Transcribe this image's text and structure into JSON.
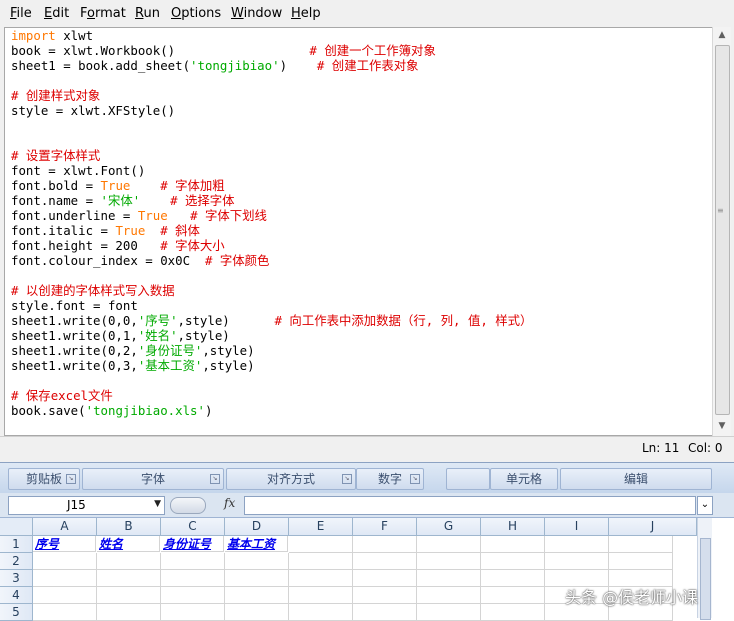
{
  "menu": [
    {
      "label": "File",
      "mnemonic": "F",
      "rest": "ile"
    },
    {
      "label": "Edit",
      "mnemonic": "E",
      "rest": "dit"
    },
    {
      "label": "Format",
      "mnemonic": "o",
      "pre": "F",
      "rest": "rmat"
    },
    {
      "label": "Run",
      "mnemonic": "R",
      "rest": "un"
    },
    {
      "label": "Options",
      "mnemonic": "O",
      "rest": "ptions"
    },
    {
      "label": "Window",
      "mnemonic": "W",
      "rest": "indow"
    },
    {
      "label": "Help",
      "mnemonic": "H",
      "rest": "elp"
    }
  ],
  "code_lines": [
    [
      {
        "t": "import",
        "c": "kw"
      },
      {
        "t": " xlwt"
      }
    ],
    [
      {
        "t": "book = xlwt.Workbook()                  "
      },
      {
        "t": "# 创建一个工作簿对象",
        "c": "cm"
      }
    ],
    [
      {
        "t": "sheet1 = book.add_sheet("
      },
      {
        "t": "'tongjibiao'",
        "c": "st"
      },
      {
        "t": ")    "
      },
      {
        "t": "# 创建工作表对象",
        "c": "cm"
      }
    ],
    [
      {
        "t": ""
      }
    ],
    [
      {
        "t": "# 创建样式对象",
        "c": "cm"
      }
    ],
    [
      {
        "t": "style = xlwt.XFStyle()"
      }
    ],
    [
      {
        "t": ""
      }
    ],
    [
      {
        "t": ""
      }
    ],
    [
      {
        "t": "# 设置字体样式",
        "c": "cm"
      }
    ],
    [
      {
        "t": "font = xlwt.Font()"
      }
    ],
    [
      {
        "t": "font.bold = "
      },
      {
        "t": "True",
        "c": "kw"
      },
      {
        "t": "    "
      },
      {
        "t": "# 字体加粗",
        "c": "cm"
      }
    ],
    [
      {
        "t": "font.name = "
      },
      {
        "t": "'宋体'",
        "c": "st"
      },
      {
        "t": "    "
      },
      {
        "t": "# 选择字体",
        "c": "cm"
      }
    ],
    [
      {
        "t": "font.underline = "
      },
      {
        "t": "True",
        "c": "kw"
      },
      {
        "t": "   "
      },
      {
        "t": "# 字体下划线",
        "c": "cm"
      }
    ],
    [
      {
        "t": "font.italic = "
      },
      {
        "t": "True",
        "c": "kw"
      },
      {
        "t": "  "
      },
      {
        "t": "# 斜体",
        "c": "cm"
      }
    ],
    [
      {
        "t": "font.height = 200   "
      },
      {
        "t": "# 字体大小",
        "c": "cm"
      }
    ],
    [
      {
        "t": "font.colour_index = 0x0C  "
      },
      {
        "t": "# 字体颜色",
        "c": "cm"
      }
    ],
    [
      {
        "t": ""
      }
    ],
    [
      {
        "t": "# 以创建的字体样式写入数据",
        "c": "cm"
      }
    ],
    [
      {
        "t": "style.font = font"
      }
    ],
    [
      {
        "t": "sheet1.write(0,0,"
      },
      {
        "t": "'序号'",
        "c": "st"
      },
      {
        "t": ",style)      "
      },
      {
        "t": "# 向工作表中添加数据（行, 列, 值, 样式）",
        "c": "cm"
      }
    ],
    [
      {
        "t": "sheet1.write(0,1,"
      },
      {
        "t": "'姓名'",
        "c": "st"
      },
      {
        "t": ",style)"
      }
    ],
    [
      {
        "t": "sheet1.write(0,2,"
      },
      {
        "t": "'身份证号'",
        "c": "st"
      },
      {
        "t": ",style)"
      }
    ],
    [
      {
        "t": "sheet1.write(0,3,"
      },
      {
        "t": "'基本工资'",
        "c": "st"
      },
      {
        "t": ",style)"
      }
    ],
    [
      {
        "t": ""
      }
    ],
    [
      {
        "t": "# 保存excel文件",
        "c": "cm"
      }
    ],
    [
      {
        "t": "book.save("
      },
      {
        "t": "'tongjibiao.xls'",
        "c": "st"
      },
      {
        "t": ")"
      }
    ]
  ],
  "status": {
    "ln": "Ln: 11",
    "col": "Col: 0"
  },
  "ribbon_groups": [
    "剪贴板",
    "字体",
    "对齐方式",
    "数字",
    "",
    "单元格",
    "编辑"
  ],
  "name_box": "J15",
  "fx_label": "fx",
  "columns": [
    "A",
    "B",
    "C",
    "D",
    "E",
    "F",
    "G",
    "H",
    "I",
    "J"
  ],
  "rows": [
    "1",
    "2",
    "3",
    "4",
    "5"
  ],
  "row1_cells": [
    "序号",
    "姓名",
    "身份证号",
    "基本工资"
  ],
  "watermark": "头条 @侯老师小课"
}
